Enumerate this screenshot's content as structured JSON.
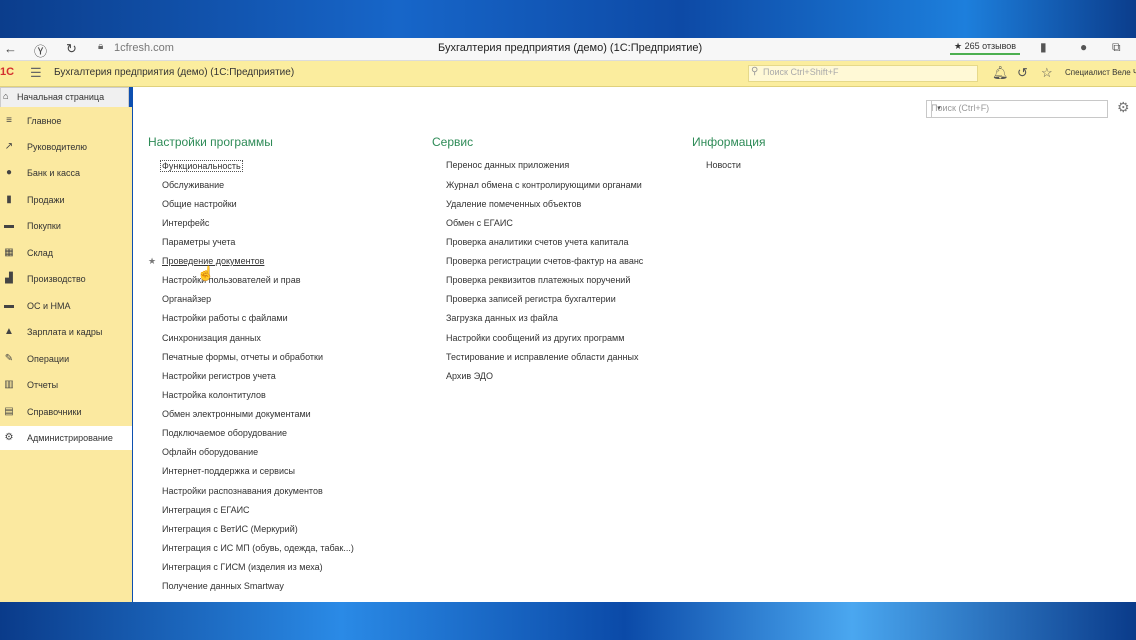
{
  "browser": {
    "url": "1cfresh.com",
    "title": "Бухгалтерия предприятия (демо) (1С:Предприятие)",
    "reviews": "★ 265 отзывов"
  },
  "app": {
    "logo": "1С",
    "title": "Бухгалтерия предприятия (демо) (1С:Предприятие)",
    "search_placeholder": "Поиск Ctrl+Shift+F",
    "user": "Специалист Веле Ч"
  },
  "home_tab": "Начальная страница",
  "sidebar": {
    "items": [
      {
        "label": "Главное",
        "icon": "≡"
      },
      {
        "label": "Руководителю",
        "icon": "↗"
      },
      {
        "label": "Банк и касса",
        "icon": "●"
      },
      {
        "label": "Продажи",
        "icon": "▮"
      },
      {
        "label": "Покупки",
        "icon": "▬"
      },
      {
        "label": "Склад",
        "icon": "▦"
      },
      {
        "label": "Производство",
        "icon": "▟"
      },
      {
        "label": "ОС и НМА",
        "icon": "▬"
      },
      {
        "label": "Зарплата и кадры",
        "icon": "▲"
      },
      {
        "label": "Операции",
        "icon": "✎"
      },
      {
        "label": "Отчеты",
        "icon": "▥"
      },
      {
        "label": "Справочники",
        "icon": "▤"
      },
      {
        "label": "Администрирование",
        "icon": "⚙"
      }
    ]
  },
  "main": {
    "search_placeholder": "Поиск (Ctrl+F)",
    "columns": [
      {
        "title": "Настройки программы",
        "links": [
          "Функциональность",
          "Обслуживание",
          "Общие настройки",
          "Интерфейс",
          "Параметры учета",
          "Проведение документов",
          "Настройки пользователей и прав",
          "Органайзер",
          "Настройки работы с файлами",
          "Синхронизация данных",
          "Печатные формы, отчеты и обработки",
          "Настройки регистров учета",
          "Настройка колонтитулов",
          "Обмен электронными документами",
          "Подключаемое оборудование",
          "Офлайн оборудование",
          "Интернет-поддержка и сервисы",
          "Настройки распознавания документов",
          "Интеграция с ЕГАИС",
          "Интеграция с ВетИС (Меркурий)",
          "Интеграция с ИС МП (обувь, одежда, табак...)",
          "Интеграция с ГИСМ (изделия из меха)",
          "Получение данных Smartway"
        ]
      },
      {
        "title": "Сервис",
        "links": [
          "Перенос данных приложения",
          "Журнал обмена с контролирующими органами",
          "Удаление помеченных объектов",
          "Обмен с ЕГАИС",
          "Проверка аналитики счетов учета капитала",
          "Проверка регистрации счетов-фактур на аванс",
          "Проверка реквизитов платежных поручений",
          "Проверка записей регистра бухгалтерии",
          "Загрузка данных из файла",
          "Настройки сообщений из других программ",
          "Тестирование и исправление области данных",
          "Архив ЭДО"
        ]
      },
      {
        "title": "Информация",
        "links": [
          "Новости"
        ]
      }
    ]
  }
}
